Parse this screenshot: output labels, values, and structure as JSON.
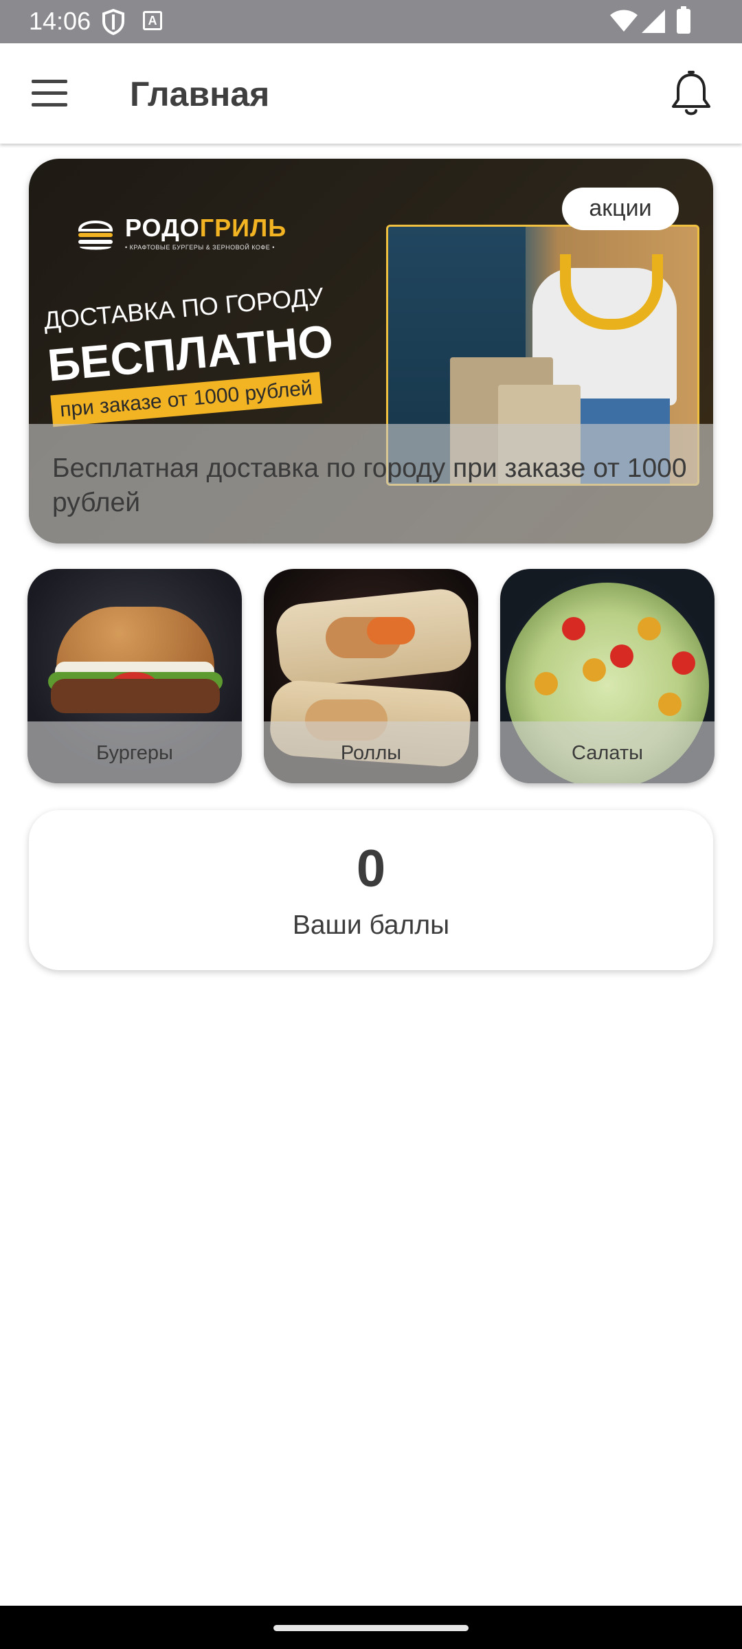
{
  "status_bar": {
    "time": "14:06",
    "keyboard_indicator": "A",
    "icons": [
      "shield-icon",
      "keyboard-icon",
      "wifi-icon",
      "signal-icon",
      "battery-icon"
    ]
  },
  "app_bar": {
    "title": "Главная",
    "menu_icon": "hamburger-menu-icon",
    "notifications_icon": "bell-icon"
  },
  "promo": {
    "badge": "акции",
    "brand": {
      "name_part1": "РОДО",
      "name_part2": "ГРИЛЬ",
      "tagline": "• КРАФТОВЫЕ БУРГЕРЫ & ЗЕРНОВОЙ КОФЕ •"
    },
    "headline_line1": "ДОСТАВКА ПО ГОРОДУ",
    "headline_line2": "БЕСПЛАТНО",
    "headline_line3": "при заказе от 1000 рублей",
    "caption": "Бесплатная доставка по городу при заказе от 1000 рублей",
    "accent_color": "#f2b423"
  },
  "categories": [
    {
      "label": "Бургеры"
    },
    {
      "label": "Роллы"
    },
    {
      "label": "Салаты"
    }
  ],
  "points": {
    "value": "0",
    "label": "Ваши баллы"
  }
}
